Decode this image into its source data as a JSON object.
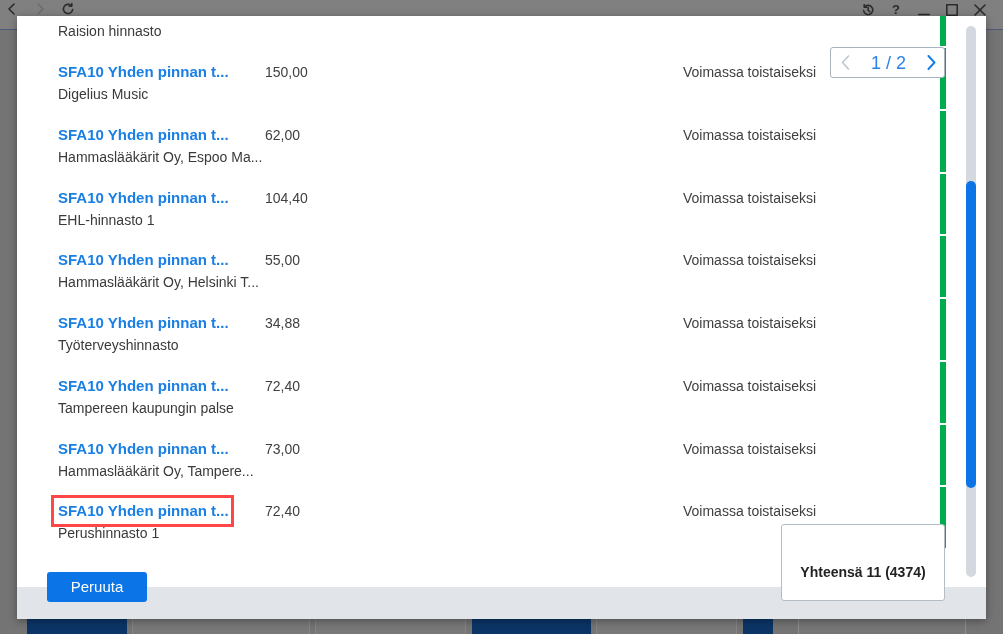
{
  "toolbar": {
    "back": {
      "disabled": false
    },
    "forward": {
      "disabled": true
    },
    "help": "?"
  },
  "dialog": {
    "pager": {
      "label": "1 / 2",
      "previous": {
        "disabled": true
      },
      "next": {
        "disabled": false
      }
    },
    "rows": [
      {
        "customer": "Raision hinnasto",
        "color": "#00ad4e"
      },
      {
        "title": "SFA10 Yhden pinnan t...",
        "price": "150,00",
        "customer": "Digelius Music",
        "status": "Voimassa toistaiseksi",
        "color": "#00ad4e",
        "highlighted": false
      },
      {
        "title": "SFA10 Yhden pinnan t...",
        "price": "62,00",
        "customer": "Hammaslääkärit Oy, Espoo Ma...",
        "status": "Voimassa toistaiseksi",
        "color": "#00ad4e",
        "highlighted": false
      },
      {
        "title": "SFA10 Yhden pinnan t...",
        "price": "104,40",
        "customer": "EHL-hinnasto 1",
        "status": "Voimassa toistaiseksi",
        "color": "#00ad4e",
        "highlighted": false
      },
      {
        "title": "SFA10 Yhden pinnan t...",
        "price": "55,00",
        "customer": "Hammaslääkärit Oy, Helsinki T...",
        "status": "Voimassa toistaiseksi",
        "color": "#00ad4e",
        "highlighted": false
      },
      {
        "title": "SFA10 Yhden pinnan t...",
        "price": "34,88",
        "customer": "Työterveyshinnasto",
        "status": "Voimassa toistaiseksi",
        "color": "#00ad4e",
        "highlighted": false
      },
      {
        "title": "SFA10 Yhden pinnan t...",
        "price": "72,40",
        "customer": "Tampereen kaupungin palse",
        "status": "Voimassa toistaiseksi",
        "color": "#00ad4e",
        "highlighted": false
      },
      {
        "title": "SFA10 Yhden pinnan t...",
        "price": "73,00",
        "customer": "Hammaslääkärit Oy, Tampere...",
        "status": "Voimassa toistaiseksi",
        "color": "#00ad4e",
        "highlighted": false
      },
      {
        "title": "SFA10 Yhden pinnan t...",
        "price": "72,40",
        "customer": "Perushinnasto 1",
        "status": "Voimassa toistaiseksi",
        "color": "#00ad4e",
        "highlighted": true
      }
    ],
    "total": "Yhteensä 11 (4374)",
    "cancel_button": "Peruuta"
  }
}
